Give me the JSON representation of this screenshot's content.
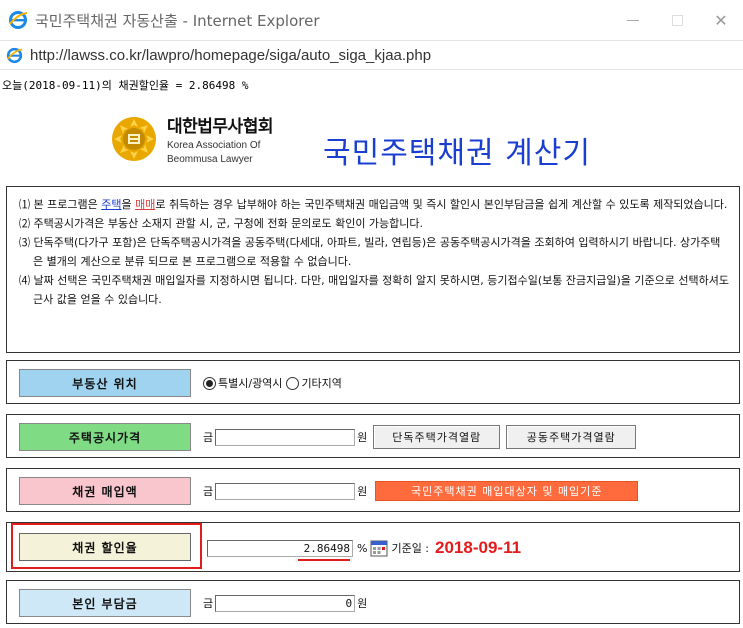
{
  "window": {
    "title": "국민주택채권 자동산출 - Internet Explorer",
    "minimize": "—",
    "maximize": "□",
    "close": "✕"
  },
  "address": {
    "url": "http://lawss.co.kr/lawpro/homepage/siga/auto_siga_kjaa.php"
  },
  "rate_line": "오늘(2018-09-11)의 채권할인율 = 2.86498 %",
  "logo": {
    "name_ko": "대한법무사협회",
    "name_en_1": "Korea Association Of",
    "name_en_2": "Beommusa Lawyer"
  },
  "heading": "국민주택채권 계산기",
  "notice": {
    "item1_pre": "⑴ 본 프로그램은 ",
    "item1_link1": "주택",
    "item1_mid": "을 ",
    "item1_link2": "매매",
    "item1_post": "로 취득하는 경우 납부해야 하는 국민주택채권 매입금액 및 즉시 할인시 본인부담금을 쉽게 계산할 수 있도록 제작되었습니다.",
    "item2": "⑵ 주택공시가격은 부동산 소재지 관할 시, 군, 구청에 전화 문의로도 확인이 가능합니다.",
    "item3": "⑶ 단독주택(다가구 포함)은 단독주택공시가격을 공동주택(다세대, 아파트, 빌라, 연립등)은 공동주택공시가격을 조회하여 입력하시기 바랍니다. 상가주택은 별개의 계산으로 분류 되므로 본 프로그램으로 적용할 수 없습니다.",
    "item4": "⑷ 날짜 선택은 국민주택채권 매입일자를 지정하시면 됩니다. 다만, 매입일자를 정확히 알지 못하시면, 등기접수일(보통 잔금지급일)을 기준으로 선택하셔도 근사 값을 얻을 수 있습니다."
  },
  "rows": {
    "location": {
      "label": "부동산 위치",
      "option1": "특별시/광역시",
      "option2": "기타지역"
    },
    "price": {
      "label": "주택공시가격",
      "prefix": "금",
      "suffix": "원",
      "btn_single": "단독주택가격열람",
      "btn_apt": "공동주택가격열람"
    },
    "purchase": {
      "label": "채권 매입액",
      "prefix": "금",
      "suffix": "원",
      "btn_info": "국민주택채권 매입대상자 및 매입기준"
    },
    "discount": {
      "label": "채권 할인율",
      "value": "2.86498",
      "unit": "%",
      "date_label": "기준일 :",
      "date": "2018-09-11"
    },
    "burden": {
      "label": "본인 부담금",
      "prefix": "금",
      "value": "0",
      "suffix": "원"
    }
  },
  "colors": {
    "heading_blue": "#1a3fd0",
    "accent_red": "#e41b1b",
    "orange_button": "#ff6b3d"
  },
  "icons": [
    "ie-icon",
    "minimize-icon",
    "maximize-icon",
    "close-icon",
    "calendar-icon",
    "emblem-icon"
  ]
}
